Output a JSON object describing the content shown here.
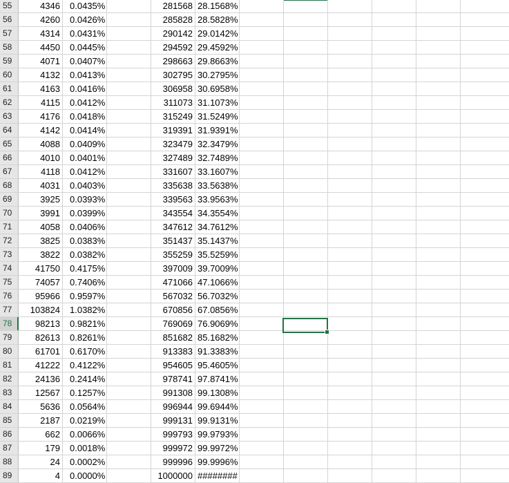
{
  "sheet": {
    "selected_row": "78",
    "rows": [
      {
        "n": "55",
        "a": "4346",
        "b": "0.0435%",
        "c": "281568",
        "d": "28.1568%"
      },
      {
        "n": "56",
        "a": "4260",
        "b": "0.0426%",
        "c": "285828",
        "d": "28.5828%"
      },
      {
        "n": "57",
        "a": "4314",
        "b": "0.0431%",
        "c": "290142",
        "d": "29.0142%"
      },
      {
        "n": "58",
        "a": "4450",
        "b": "0.0445%",
        "c": "294592",
        "d": "29.4592%"
      },
      {
        "n": "59",
        "a": "4071",
        "b": "0.0407%",
        "c": "298663",
        "d": "29.8663%"
      },
      {
        "n": "60",
        "a": "4132",
        "b": "0.0413%",
        "c": "302795",
        "d": "30.2795%"
      },
      {
        "n": "61",
        "a": "4163",
        "b": "0.0416%",
        "c": "306958",
        "d": "30.6958%"
      },
      {
        "n": "62",
        "a": "4115",
        "b": "0.0412%",
        "c": "311073",
        "d": "31.1073%"
      },
      {
        "n": "63",
        "a": "4176",
        "b": "0.0418%",
        "c": "315249",
        "d": "31.5249%"
      },
      {
        "n": "64",
        "a": "4142",
        "b": "0.0414%",
        "c": "319391",
        "d": "31.9391%"
      },
      {
        "n": "65",
        "a": "4088",
        "b": "0.0409%",
        "c": "323479",
        "d": "32.3479%"
      },
      {
        "n": "66",
        "a": "4010",
        "b": "0.0401%",
        "c": "327489",
        "d": "32.7489%"
      },
      {
        "n": "67",
        "a": "4118",
        "b": "0.0412%",
        "c": "331607",
        "d": "33.1607%"
      },
      {
        "n": "68",
        "a": "4031",
        "b": "0.0403%",
        "c": "335638",
        "d": "33.5638%"
      },
      {
        "n": "69",
        "a": "3925",
        "b": "0.0393%",
        "c": "339563",
        "d": "33.9563%"
      },
      {
        "n": "70",
        "a": "3991",
        "b": "0.0399%",
        "c": "343554",
        "d": "34.3554%"
      },
      {
        "n": "71",
        "a": "4058",
        "b": "0.0406%",
        "c": "347612",
        "d": "34.7612%"
      },
      {
        "n": "72",
        "a": "3825",
        "b": "0.0383%",
        "c": "351437",
        "d": "35.1437%"
      },
      {
        "n": "73",
        "a": "3822",
        "b": "0.0382%",
        "c": "355259",
        "d": "35.5259%"
      },
      {
        "n": "74",
        "a": "41750",
        "b": "0.4175%",
        "c": "397009",
        "d": "39.7009%"
      },
      {
        "n": "75",
        "a": "74057",
        "b": "0.7406%",
        "c": "471066",
        "d": "47.1066%"
      },
      {
        "n": "76",
        "a": "95966",
        "b": "0.9597%",
        "c": "567032",
        "d": "56.7032%"
      },
      {
        "n": "77",
        "a": "103824",
        "b": "1.0382%",
        "c": "670856",
        "d": "67.0856%"
      },
      {
        "n": "78",
        "a": "98213",
        "b": "0.9821%",
        "c": "769069",
        "d": "76.9069%"
      },
      {
        "n": "79",
        "a": "82613",
        "b": "0.8261%",
        "c": "851682",
        "d": "85.1682%"
      },
      {
        "n": "80",
        "a": "61701",
        "b": "0.6170%",
        "c": "913383",
        "d": "91.3383%"
      },
      {
        "n": "81",
        "a": "41222",
        "b": "0.4122%",
        "c": "954605",
        "d": "95.4605%"
      },
      {
        "n": "82",
        "a": "24136",
        "b": "0.2414%",
        "c": "978741",
        "d": "97.8741%"
      },
      {
        "n": "83",
        "a": "12567",
        "b": "0.1257%",
        "c": "991308",
        "d": "99.1308%"
      },
      {
        "n": "84",
        "a": "5636",
        "b": "0.0564%",
        "c": "996944",
        "d": "99.6944%"
      },
      {
        "n": "85",
        "a": "2187",
        "b": "0.0219%",
        "c": "999131",
        "d": "99.9131%"
      },
      {
        "n": "86",
        "a": "662",
        "b": "0.0066%",
        "c": "999793",
        "d": "99.9793%"
      },
      {
        "n": "87",
        "a": "179",
        "b": "0.0018%",
        "c": "999972",
        "d": "99.9972%"
      },
      {
        "n": "88",
        "a": "24",
        "b": "0.0002%",
        "c": "999996",
        "d": "99.9996%"
      },
      {
        "n": "89",
        "a": "4",
        "b": "0.0000%",
        "c": "1000000",
        "d": "########"
      }
    ]
  },
  "colors": {
    "accent": "#217346",
    "gridline": "#d4d4d4",
    "header_bg": "#e6e6e6"
  }
}
